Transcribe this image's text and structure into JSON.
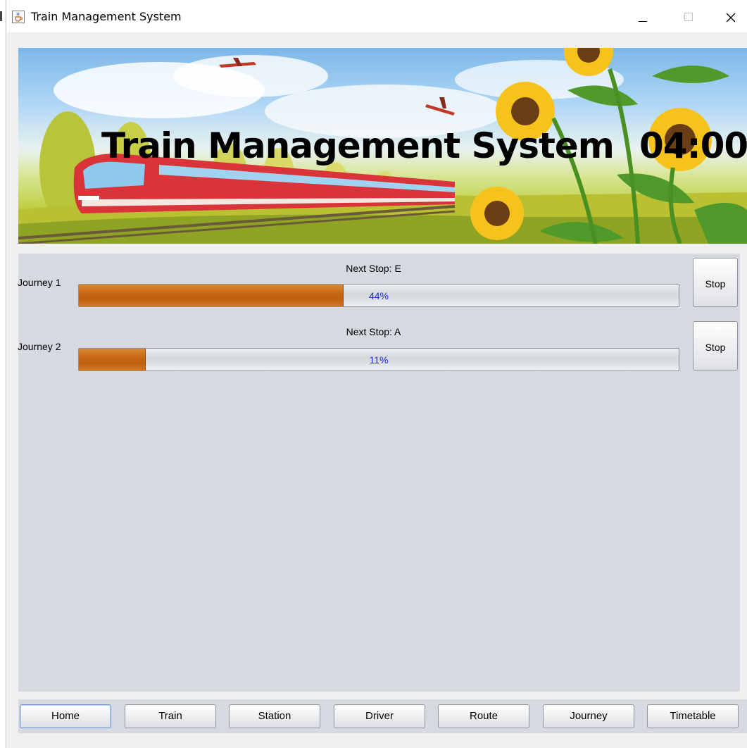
{
  "window": {
    "title": "Train Management System"
  },
  "banner": {
    "title": "Train Management System",
    "clock": "04:00"
  },
  "journeys": [
    {
      "label": "Journey 1",
      "next_stop": "Next Stop: E",
      "progress_percent": 44,
      "progress_text": "44%",
      "stop_label": "Stop"
    },
    {
      "label": "Journey 2",
      "next_stop": "Next Stop: A",
      "progress_percent": 11,
      "progress_text": "11%",
      "stop_label": "Stop"
    }
  ],
  "nav": {
    "active": "Home",
    "buttons": [
      "Home",
      "Train",
      "Station",
      "Driver",
      "Route",
      "Journey",
      "Timetable"
    ]
  },
  "colors": {
    "progress_fill": "#c96b15",
    "progress_text": "#1d2bd6",
    "panel_bg": "#d6d9df"
  },
  "icons": {
    "app": "java-cup-icon",
    "minimize": "minimize-icon",
    "maximize": "maximize-icon",
    "close": "close-icon"
  }
}
